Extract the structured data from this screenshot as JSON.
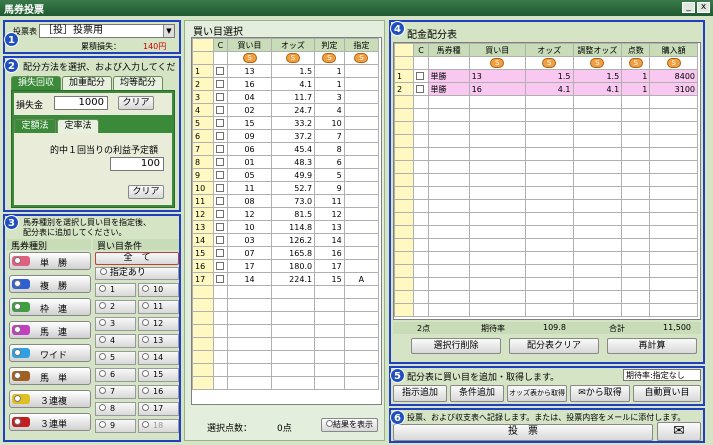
{
  "window": {
    "title": "馬券投票",
    "min": "_",
    "close": "x"
  },
  "badges": [
    "1",
    "2",
    "3",
    "4",
    "5",
    "6"
  ],
  "sec1": {
    "label": "投票表",
    "select": "［投］投票用",
    "loss_label": "累積損失：",
    "loss_value": "140円"
  },
  "sec2": {
    "heading": "配分方法を選択、および入力してください。",
    "tabs": [
      "損失回収",
      "加重配分",
      "均等配分"
    ],
    "loss_label": "損失金",
    "loss_value": "1000",
    "clear": "クリア",
    "subtabs": [
      "定額法",
      "定率法"
    ],
    "desc": "的中１回当りの利益予定額",
    "amount": "100",
    "clear2": "クリア"
  },
  "sec3": {
    "heading1": "馬券種別を選択し買い目を指定後、",
    "heading2": "配分表に追加してください。",
    "col1": "馬券種別",
    "col2": "買い目条件",
    "types": [
      {
        "label": "単　勝",
        "color": "#e06080"
      },
      {
        "label": "複　勝",
        "color": "#3060d0"
      },
      {
        "label": "枠　連",
        "color": "#40a040"
      },
      {
        "label": "馬　連",
        "color": "#c040c0"
      },
      {
        "label": "ワイド",
        "color": "#30a0e0"
      },
      {
        "label": "馬　単",
        "color": "#a06020"
      },
      {
        "label": "３連複",
        "color": "#e0c020"
      },
      {
        "label": "３連単",
        "color": "#c02020"
      }
    ],
    "all": "全　て",
    "specified": "指定あり",
    "nums": [
      "1",
      "10",
      "2",
      "11",
      "3",
      "12",
      "4",
      "13",
      "5",
      "14",
      "6",
      "15",
      "7",
      "16",
      "8",
      "17",
      "9",
      "18"
    ]
  },
  "sel": {
    "title": "買い目選択",
    "headers": [
      "C",
      "買い目",
      "オッズ",
      "判定",
      "指定"
    ],
    "rows": [
      [
        "1",
        "13",
        "1.5",
        "1",
        ""
      ],
      [
        "2",
        "16",
        "4.1",
        "1",
        ""
      ],
      [
        "3",
        "04",
        "11.7",
        "3",
        ""
      ],
      [
        "4",
        "02",
        "24.7",
        "4",
        ""
      ],
      [
        "5",
        "15",
        "33.2",
        "10",
        ""
      ],
      [
        "6",
        "09",
        "37.2",
        "7",
        ""
      ],
      [
        "7",
        "06",
        "45.4",
        "8",
        ""
      ],
      [
        "8",
        "01",
        "48.3",
        "6",
        ""
      ],
      [
        "9",
        "05",
        "49.9",
        "5",
        ""
      ],
      [
        "10",
        "11",
        "52.7",
        "9",
        ""
      ],
      [
        "11",
        "08",
        "73.0",
        "11",
        ""
      ],
      [
        "12",
        "12",
        "81.5",
        "12",
        ""
      ],
      [
        "13",
        "10",
        "114.8",
        "13",
        ""
      ],
      [
        "14",
        "03",
        "126.2",
        "14",
        ""
      ],
      [
        "15",
        "07",
        "165.8",
        "16",
        ""
      ],
      [
        "16",
        "17",
        "180.0",
        "17",
        ""
      ],
      [
        "17",
        "14",
        "224.1",
        "15",
        "A"
      ]
    ],
    "count_label": "選択点数：",
    "count": "0点",
    "show_result": "結果を表示"
  },
  "dist": {
    "title": "配金配分表",
    "headers": [
      "C",
      "馬券種",
      "買い目",
      "オッズ",
      "調整オッズ",
      "点数",
      "購入額"
    ],
    "rows": [
      [
        "1",
        "単勝",
        "13",
        "1.5",
        "1.5",
        "1",
        "8400"
      ],
      [
        "2",
        "単勝",
        "16",
        "4.1",
        "4.1",
        "1",
        "3100"
      ]
    ],
    "footer": {
      "points": "2点",
      "label": "期待率",
      "rate": "109.8",
      "total_label": "合計",
      "total": "11,500"
    },
    "buttons": [
      "選択行削除",
      "配分表クリア",
      "再計算"
    ]
  },
  "sec5": {
    "heading": "配分表に買い目を追加・取得します。",
    "select": "期待率:指定なし",
    "buttons": [
      "指示追加",
      "条件追加",
      "オッズ表から取得",
      "から取得",
      "自動買い目"
    ]
  },
  "sec6": {
    "heading": "投票、および収支表へ記録します。または、投票内容をメールに添付します。",
    "vote": "投　票"
  },
  "colors": {
    "accent": "#2040c0",
    "selection": "#f8c8f0"
  }
}
